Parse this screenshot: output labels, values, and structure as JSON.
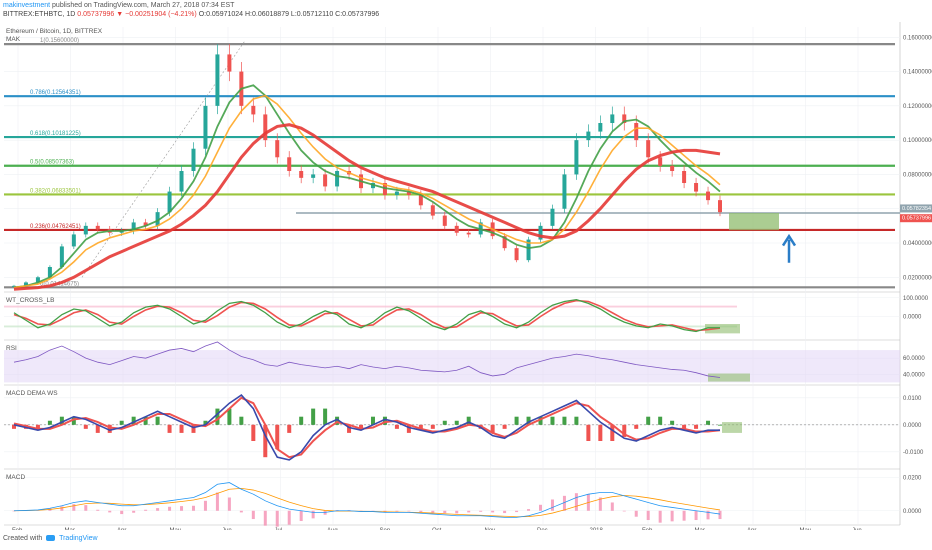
{
  "header": {
    "author": "makinvestment",
    "published_text": "published on TradingView.com, March 27, 2018 07:34 EST",
    "symbol": "BITTREX:ETHBTC, 1D",
    "last_price": "0.05737996",
    "change": "▼ −0.00251904 (−4.21%)",
    "ohlc": "O:0.05971024 H:0.06018879 L:0.05712110 C:0.05737996"
  },
  "footer": {
    "created_with": "Created with",
    "brand": "TradingView"
  },
  "colors": {
    "up": "#26a69a",
    "down": "#ef5350",
    "ma_fast": "#43a047",
    "ma_mid": "#ffa726",
    "ma_slow": "#e53935",
    "fib_gray": "#888888",
    "fib_blue": "#2a8fc7",
    "fib_teal": "#26a69a",
    "fib_green": "#4caf50",
    "fib_lime": "#9bc53d",
    "fib_red": "#c62828",
    "arrow": "#2a7dc7",
    "box": "#8fbc6e",
    "rsi": "#7e57c2",
    "wt_pink": "#f8bbd0"
  },
  "chart_data": [
    {
      "type": "line",
      "panel": "price",
      "title": "Ethereum / Bitcoin, 1D, BITTREX",
      "indicator": "MAK",
      "x_axis_labels": [
        "Feb",
        "Mar",
        "Apr",
        "May",
        "Jun",
        "Jul",
        "Aug",
        "Sep",
        "Oct",
        "Nov",
        "Dec",
        "2018",
        "Feb",
        "Mar",
        "Apr",
        "May",
        "Jun"
      ],
      "y_tick_labels": [
        "0.16000000",
        "0.14000000",
        "0.12000000",
        "0.10000000",
        "0.08000000",
        "0.06000000",
        "0.04000000",
        "0.02000000"
      ],
      "ylim": [
        0.012,
        0.166
      ],
      "price_labels": [
        "0.05782354",
        "0.05737996"
      ],
      "fib_levels": [
        {
          "label": "1(0.15600000)",
          "value": 0.156
        },
        {
          "label": "0.786(0.12564351)",
          "value": 0.12564
        },
        {
          "label": "0.618(0.10181225)",
          "value": 0.10181
        },
        {
          "label": "0.5(0.08507363)",
          "value": 0.08507
        },
        {
          "label": "0.382(0.06833501)",
          "value": 0.06834
        },
        {
          "label": "0.236(0.04762451)",
          "value": 0.04762
        },
        {
          "label": "0(0.01414675)",
          "value": 0.01415
        }
      ],
      "series": [
        {
          "values": [
            0.015,
            0.017,
            0.02,
            0.026,
            0.038,
            0.045,
            0.05,
            0.048,
            0.046,
            0.047,
            0.052,
            0.05,
            0.058,
            0.07,
            0.082,
            0.095,
            0.12,
            0.15,
            0.14,
            0.12,
            0.115,
            0.1,
            0.09,
            0.082,
            0.078,
            0.08,
            0.073,
            0.082,
            0.08,
            0.072,
            0.075,
            0.068,
            0.07,
            0.068,
            0.062,
            0.056,
            0.05,
            0.046,
            0.045,
            0.052,
            0.044,
            0.037,
            0.03,
            0.042,
            0.05,
            0.06,
            0.08,
            0.1,
            0.105,
            0.11,
            0.115,
            0.11,
            0.1,
            0.09,
            0.085,
            0.082,
            0.075,
            0.07,
            0.065,
            0.058
          ]
        },
        {
          "values": [
            0.014,
            0.015,
            0.017,
            0.02,
            0.026,
            0.034,
            0.042,
            0.046,
            0.047,
            0.047,
            0.048,
            0.05,
            0.053,
            0.058,
            0.066,
            0.076,
            0.09,
            0.108,
            0.122,
            0.13,
            0.132,
            0.126,
            0.115,
            0.104,
            0.094,
            0.087,
            0.082,
            0.079,
            0.078,
            0.076,
            0.074,
            0.072,
            0.071,
            0.07,
            0.068,
            0.064,
            0.059,
            0.054,
            0.05,
            0.048,
            0.046,
            0.043,
            0.039,
            0.037,
            0.038,
            0.042,
            0.052,
            0.066,
            0.082,
            0.095,
            0.105,
            0.111,
            0.112,
            0.108,
            0.1,
            0.093,
            0.087,
            0.081,
            0.076,
            0.07
          ]
        },
        {
          "values": [
            0.014,
            0.015,
            0.016,
            0.019,
            0.023,
            0.029,
            0.036,
            0.04,
            0.043,
            0.045,
            0.047,
            0.048,
            0.05,
            0.054,
            0.06,
            0.068,
            0.079,
            0.093,
            0.107,
            0.117,
            0.124,
            0.126,
            0.121,
            0.113,
            0.104,
            0.096,
            0.089,
            0.084,
            0.081,
            0.078,
            0.076,
            0.074,
            0.072,
            0.071,
            0.069,
            0.066,
            0.062,
            0.058,
            0.054,
            0.051,
            0.048,
            0.045,
            0.042,
            0.04,
            0.04,
            0.042,
            0.048,
            0.058,
            0.07,
            0.083,
            0.094,
            0.102,
            0.107,
            0.107,
            0.103,
            0.097,
            0.091,
            0.085,
            0.08,
            0.074
          ]
        },
        {
          "values": [
            0.013,
            0.0135,
            0.014,
            0.015,
            0.017,
            0.02,
            0.024,
            0.028,
            0.032,
            0.035,
            0.038,
            0.041,
            0.044,
            0.047,
            0.051,
            0.056,
            0.062,
            0.07,
            0.08,
            0.09,
            0.098,
            0.104,
            0.108,
            0.109,
            0.107,
            0.103,
            0.098,
            0.093,
            0.088,
            0.084,
            0.081,
            0.078,
            0.076,
            0.074,
            0.072,
            0.07,
            0.067,
            0.064,
            0.061,
            0.058,
            0.055,
            0.052,
            0.049,
            0.046,
            0.044,
            0.043,
            0.044,
            0.047,
            0.053,
            0.06,
            0.068,
            0.076,
            0.083,
            0.088,
            0.091,
            0.093,
            0.094,
            0.094,
            0.093,
            0.092
          ]
        }
      ]
    },
    {
      "type": "line",
      "panel": "wt_cross",
      "indicator": "WT_CROSS_LB",
      "y_tick_labels": [
        "100.0000",
        "0.0000"
      ],
      "ylim": [
        -120,
        120
      ],
      "series": [
        {
          "values": [
            20,
            -20,
            -60,
            -40,
            10,
            40,
            30,
            -10,
            -50,
            -30,
            20,
            50,
            60,
            40,
            0,
            -40,
            -20,
            30,
            70,
            80,
            60,
            20,
            -30,
            -60,
            -40,
            0,
            30,
            10,
            -40,
            -60,
            -30,
            20,
            50,
            30,
            -10,
            -50,
            -70,
            -40,
            10,
            30,
            0,
            -40,
            -60,
            -30,
            20,
            60,
            80,
            90,
            70,
            40,
            0,
            -30,
            -50,
            -60,
            -40,
            -50,
            -70,
            -80,
            -60,
            -60
          ]
        },
        {
          "values": [
            10,
            -10,
            -40,
            -45,
            -15,
            20,
            35,
            10,
            -30,
            -40,
            0,
            35,
            55,
            50,
            20,
            -20,
            -30,
            5,
            50,
            75,
            70,
            40,
            -5,
            -45,
            -50,
            -20,
            15,
            20,
            -15,
            -50,
            -45,
            0,
            35,
            40,
            10,
            -30,
            -60,
            -55,
            -15,
            20,
            15,
            -20,
            -50,
            -45,
            0,
            40,
            70,
            85,
            80,
            55,
            20,
            -15,
            -40,
            -55,
            -50,
            -45,
            -60,
            -75,
            -70,
            -62
          ]
        }
      ]
    },
    {
      "type": "line",
      "panel": "rsi",
      "indicator": "RSI",
      "y_tick_labels": [
        "60.0000",
        "40.0000"
      ],
      "ylim": [
        28,
        80
      ],
      "series": [
        {
          "values": [
            55,
            58,
            62,
            70,
            75,
            68,
            60,
            55,
            52,
            57,
            62,
            60,
            65,
            70,
            72,
            68,
            75,
            80,
            70,
            62,
            58,
            52,
            50,
            55,
            52,
            50,
            48,
            50,
            47,
            52,
            49,
            47,
            50,
            48,
            45,
            44,
            43,
            45,
            50,
            42,
            38,
            40,
            48,
            52,
            56,
            60,
            62,
            65,
            63,
            60,
            58,
            55,
            52,
            50,
            48,
            46,
            45,
            42,
            38,
            36
          ]
        }
      ]
    },
    {
      "type": "line",
      "panel": "macd_dema",
      "indicator": "MACD DEMA WS",
      "y_tick_labels": [
        "0.0100",
        "0.0000",
        "-0.0100"
      ],
      "ylim": [
        -0.016,
        0.014
      ],
      "series": [
        {
          "values": [
            0,
            -0.001,
            -0.002,
            -0.001,
            0.001,
            0.003,
            0.002,
            0,
            -0.002,
            -0.001,
            0.001,
            0.003,
            0.005,
            0.003,
            0.001,
            -0.001,
            0,
            0.004,
            0.008,
            0.011,
            0.006,
            -0.004,
            -0.012,
            -0.013,
            -0.01,
            -0.004,
            0,
            0.002,
            -0.001,
            -0.002,
            0,
            0.002,
            0.001,
            -0.001,
            -0.002,
            -0.003,
            -0.002,
            -0.001,
            0.001,
            -0.001,
            -0.004,
            -0.005,
            -0.002,
            0.001,
            0.003,
            0.005,
            0.007,
            0.009,
            0.005,
            0.001,
            -0.002,
            -0.005,
            -0.006,
            -0.004,
            -0.002,
            -0.001,
            -0.002,
            -0.003,
            -0.002,
            -0.002
          ]
        },
        {
          "values": [
            0.0005,
            -0.0005,
            -0.0015,
            -0.0015,
            0,
            0.002,
            0.0025,
            0.001,
            -0.001,
            -0.0015,
            0,
            0.002,
            0.004,
            0.004,
            0.002,
            0,
            -0.0005,
            0.002,
            0.006,
            0.01,
            0.008,
            0,
            -0.009,
            -0.012,
            -0.011,
            -0.006,
            -0.002,
            0.001,
            0,
            -0.0015,
            -0.001,
            0.001,
            0.0015,
            0,
            -0.0015,
            -0.0025,
            -0.0025,
            -0.0015,
            0,
            -0.0005,
            -0.003,
            -0.0045,
            -0.003,
            0,
            0.002,
            0.004,
            0.006,
            0.008,
            0.007,
            0.003,
            0,
            -0.0035,
            -0.0055,
            -0.005,
            -0.003,
            -0.0015,
            -0.0015,
            -0.0025,
            -0.0025,
            -0.002
          ]
        }
      ]
    },
    {
      "type": "line",
      "panel": "macd",
      "indicator": "MACD",
      "y_tick_labels": [
        "0.0200",
        "0.0000"
      ],
      "ylim": [
        -0.008,
        0.024
      ],
      "series": [
        {
          "values": [
            0,
            0.0002,
            0.0005,
            0.0015,
            0.003,
            0.005,
            0.006,
            0.005,
            0.004,
            0.003,
            0.003,
            0.004,
            0.005,
            0.006,
            0.007,
            0.008,
            0.011,
            0.016,
            0.017,
            0.013,
            0.01,
            0.006,
            0.003,
            0.001,
            0,
            -0.001,
            -0.001,
            0,
            0,
            -0.0005,
            -0.0005,
            -0.001,
            -0.001,
            -0.001,
            -0.0015,
            -0.002,
            -0.0025,
            -0.003,
            -0.003,
            -0.003,
            -0.0035,
            -0.004,
            -0.004,
            -0.003,
            -0.001,
            0.002,
            0.005,
            0.008,
            0.01,
            0.011,
            0.011,
            0.009,
            0.007,
            0.005,
            0.003,
            0.002,
            0.001,
            0,
            -0.001,
            -0.002
          ]
        },
        {
          "values": [
            0,
            0.0001,
            0.0003,
            0.0008,
            0.0017,
            0.003,
            0.0043,
            0.0047,
            0.0045,
            0.004,
            0.0036,
            0.0037,
            0.0042,
            0.0048,
            0.0056,
            0.0065,
            0.008,
            0.0105,
            0.013,
            0.0135,
            0.0125,
            0.0105,
            0.0078,
            0.0052,
            0.0031,
            0.0013,
            0.0002,
            -0.0002,
            -0.0002,
            -0.0003,
            -0.0004,
            -0.0006,
            -0.0008,
            -0.0009,
            -0.0011,
            -0.0014,
            -0.0018,
            -0.0022,
            -0.0025,
            -0.0027,
            -0.003,
            -0.0033,
            -0.0036,
            -0.0035,
            -0.0028,
            -0.0014,
            0.0005,
            0.0027,
            0.005,
            0.007,
            0.0085,
            0.0092,
            0.0088,
            0.0078,
            0.0066,
            0.0052,
            0.004,
            0.0028,
            0.0016,
            0.0005
          ]
        }
      ]
    }
  ]
}
